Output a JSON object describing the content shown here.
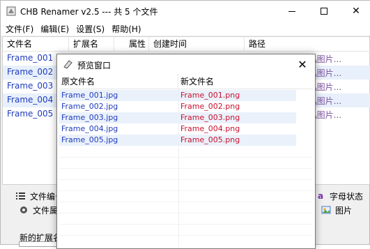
{
  "main": {
    "title": "CHB Renamer v2.5 --- 共 5 个文件",
    "menu": [
      "文件(F)",
      "编辑(E)",
      "设置(S)",
      "帮助(H)"
    ],
    "columns": [
      "文件名",
      "扩展名",
      "属性",
      "创建时间",
      "路径"
    ],
    "rows": [
      {
        "name": "Frame_001",
        "path": "ktop\\图片..."
      },
      {
        "name": "Frame_002",
        "path": "ktop\\图片..."
      },
      {
        "name": "Frame_003",
        "path": "ktop\\图片..."
      },
      {
        "name": "Frame_004",
        "path": "ktop\\图片..."
      },
      {
        "name": "Frame_005",
        "path": "ktop\\图片..."
      }
    ],
    "tabs_row1": {
      "left": "文件编号",
      "right": "字母状态",
      "right_icon_glyph": "a"
    },
    "tabs_row2": {
      "left": "文件属",
      "right": "图片"
    },
    "bottom_label": "新的扩展名"
  },
  "dialog": {
    "title": "预览窗口",
    "columns": [
      "原文件名",
      "新文件名"
    ],
    "rows": [
      {
        "old": "Frame_001.jpg",
        "new": "Frame_001.png"
      },
      {
        "old": "Frame_002.jpg",
        "new": "Frame_002.png"
      },
      {
        "old": "Frame_003.jpg",
        "new": "Frame_003.png"
      },
      {
        "old": "Frame_004.jpg",
        "new": "Frame_004.png"
      },
      {
        "old": "Frame_005.jpg",
        "new": "Frame_005.png"
      }
    ]
  },
  "colors": {
    "filename_blue": "#1f3bbd",
    "newname_red": "#c8102e",
    "path_purple": "#7b4f9d",
    "row_alt": "#e8f0fb"
  }
}
